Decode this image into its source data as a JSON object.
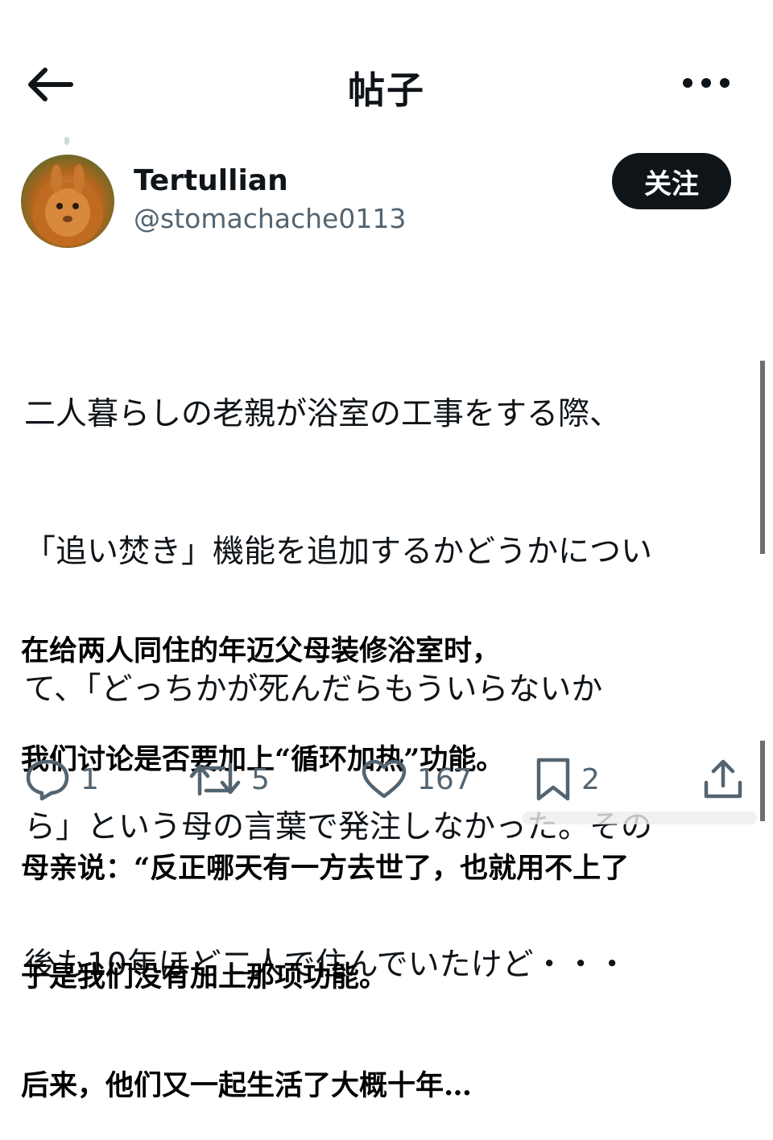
{
  "header": {
    "title": "帖子",
    "back_icon": "arrow-left-icon",
    "more_icon": "more-horizontal-icon"
  },
  "user": {
    "display_name": "Tertullian",
    "handle": "@stomachache0113",
    "follow_label": "关注",
    "avatar_icon": "avatar-rabbit-lion"
  },
  "post": {
    "text_lines": [
      "二人暮らしの老親が浴室の工事をする際、",
      "「追い焚き」機能を追加するかどうかについ",
      "て、「どっちかが死んだらもういらないか",
      "ら」という母の言葉で発注しなかった。その",
      "後も10年ほど二人で住んでいたけど・・・"
    ],
    "translation_lines": [
      "在给两人同住的年迈父母装修浴室时，",
      "我们讨论是否要加上“循环加热”功能。",
      "母亲说：“反正哪天有一方去世了，也就用不上了",
      "于是我们没有加上那项功能。",
      "后来，他们又一起生活了大概十年…"
    ]
  },
  "actions": {
    "reply": {
      "icon": "reply-icon",
      "count": "1"
    },
    "repost": {
      "icon": "repost-icon",
      "count": "5"
    },
    "like": {
      "icon": "heart-icon",
      "count": "167"
    },
    "bookmark": {
      "icon": "bookmark-icon",
      "count": "2"
    },
    "share": {
      "icon": "share-icon"
    }
  },
  "colors": {
    "text": "#0f1419",
    "secondary": "#536471",
    "button_bg": "#0f1419",
    "background": "#ffffff"
  }
}
